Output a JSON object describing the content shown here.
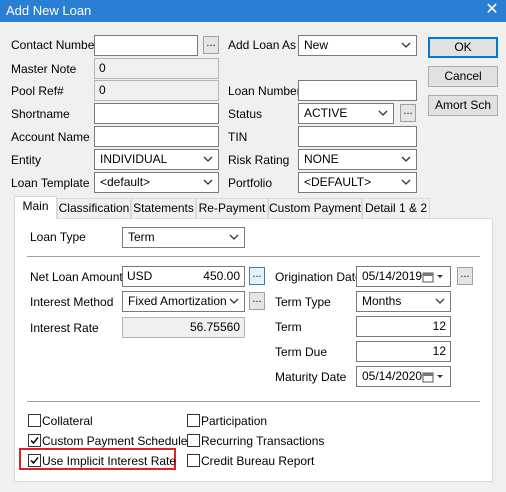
{
  "window": {
    "title": "Add New Loan",
    "close_glyph": "✕"
  },
  "buttons": {
    "ok": "OK",
    "cancel": "Cancel",
    "amort": "Amort Sch",
    "ellipsis": "..."
  },
  "top_form": {
    "contact_number": {
      "label": "Contact Number",
      "value": ""
    },
    "add_loan_as": {
      "label": "Add Loan As",
      "value": "New"
    },
    "master_note": {
      "label": "Master Note",
      "value": "0"
    },
    "pool_ref": {
      "label": "Pool Ref#",
      "value": "0"
    },
    "loan_number": {
      "label": "Loan Number",
      "value": ""
    },
    "shortname": {
      "label": "Shortname",
      "value": ""
    },
    "status": {
      "label": "Status",
      "value": "ACTIVE"
    },
    "account_name": {
      "label": "Account Name",
      "value": ""
    },
    "tin": {
      "label": "TIN",
      "value": ""
    },
    "entity": {
      "label": "Entity",
      "value": "INDIVIDUAL"
    },
    "risk_rating": {
      "label": "Risk Rating",
      "value": "NONE"
    },
    "loan_template": {
      "label": "Loan Template",
      "value": "<default>"
    },
    "portfolio": {
      "label": "Portfolio",
      "value": "<DEFAULT>"
    }
  },
  "tabs": [
    "Main",
    "Classification",
    "Statements",
    "Re-Payment",
    "Custom Payment",
    "Detail 1 & 2"
  ],
  "main": {
    "loan_type": {
      "label": "Loan Type",
      "value": "Term"
    },
    "net_loan_amount": {
      "label": "Net Loan Amount",
      "currency": "USD",
      "value": "450.00"
    },
    "interest_method": {
      "label": "Interest Method",
      "value": "Fixed Amortization"
    },
    "interest_rate": {
      "label": "Interest Rate",
      "value": "56.75560"
    },
    "origination_date": {
      "label": "Origination Date",
      "value": "05/14/2019"
    },
    "term_type": {
      "label": "Term Type",
      "value": "Months"
    },
    "term": {
      "label": "Term",
      "value": "12"
    },
    "term_due": {
      "label": "Term Due",
      "value": "12"
    },
    "maturity_date": {
      "label": "Maturity Date",
      "value": "05/14/2020"
    }
  },
  "checkboxes": [
    {
      "label": "Collateral",
      "checked": false
    },
    {
      "label": "Custom Payment Schedule",
      "checked": true
    },
    {
      "label": "Use Implicit Interest Rate",
      "checked": true
    },
    {
      "label": "Participation",
      "checked": false
    },
    {
      "label": "Recurring Transactions",
      "checked": false
    },
    {
      "label": "Credit Bureau Report",
      "checked": false
    }
  ],
  "colors": {
    "titlebar": "#2a7fd4",
    "highlight": "#e0202a",
    "default_button_border": "#0078d7"
  }
}
